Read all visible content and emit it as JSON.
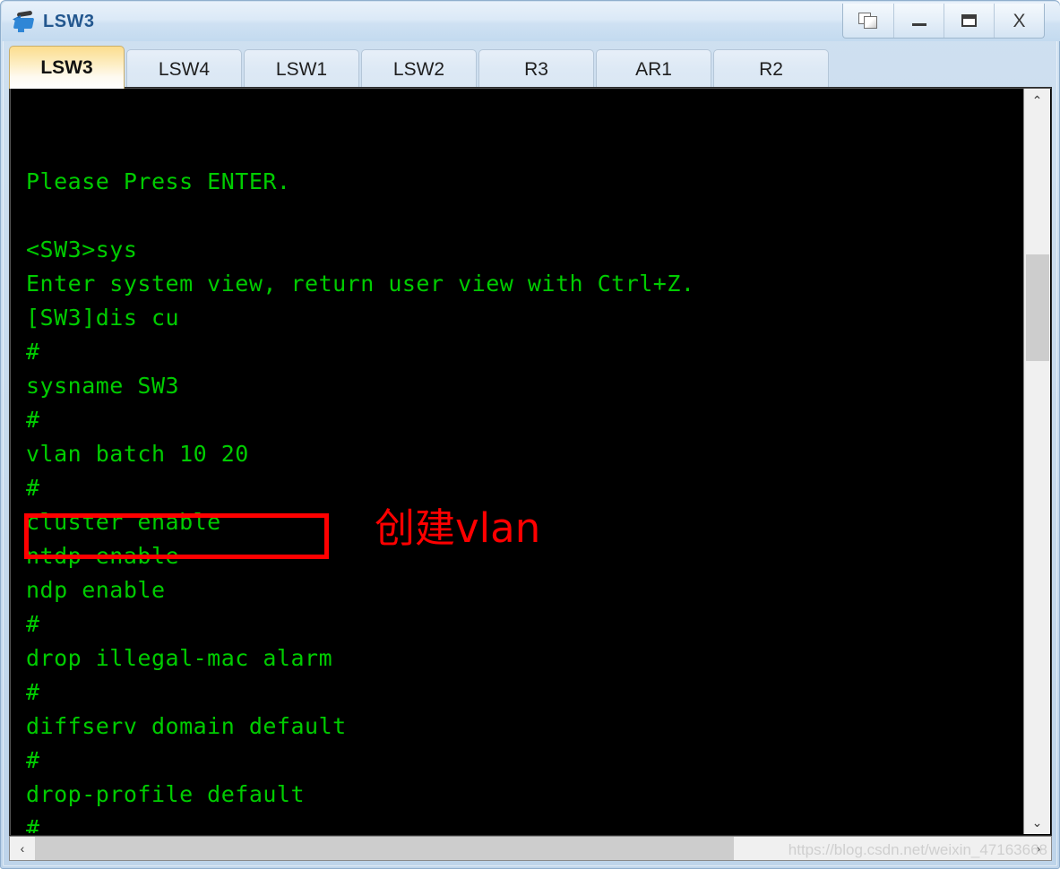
{
  "window": {
    "title": "LSW3",
    "icon": "switch-device-icon",
    "buttons": [
      {
        "name": "cascade-windows-button",
        "label": "Cascade"
      },
      {
        "name": "minimize-button",
        "label": "Minimize"
      },
      {
        "name": "maximize-button",
        "label": "Maximize"
      },
      {
        "name": "close-button",
        "label": "X"
      }
    ]
  },
  "tabs": [
    {
      "label": "LSW3",
      "active": true
    },
    {
      "label": "LSW4",
      "active": false
    },
    {
      "label": "LSW1",
      "active": false
    },
    {
      "label": "LSW2",
      "active": false
    },
    {
      "label": "R3",
      "active": false
    },
    {
      "label": "AR1",
      "active": false
    },
    {
      "label": "R2",
      "active": false
    }
  ],
  "terminal": {
    "foreground_color": "#00cc00",
    "background_color": "#000000",
    "lines": [
      "",
      "",
      "Please Press ENTER.",
      "",
      "<SW3>sys",
      "Enter system view, return user view with Ctrl+Z.",
      "[SW3]dis cu",
      "#",
      "sysname SW3",
      "#",
      "vlan batch 10 20",
      "#",
      "cluster enable",
      "ntdp enable",
      "ndp enable",
      "#",
      "drop illegal-mac alarm",
      "#",
      "diffserv domain default",
      "#",
      "drop-profile default",
      "#"
    ],
    "annotation": {
      "text": "创建vlan",
      "color": "#ff0000",
      "highlighted_line": "vlan batch 10 20"
    }
  },
  "scrollbars": {
    "vertical": {
      "up_arrow": "⌃",
      "down_arrow": "⌄"
    },
    "horizontal": {
      "left_arrow": "‹",
      "right_arrow": "›"
    }
  },
  "watermark": "https://blog.csdn.net/weixin_47163668"
}
